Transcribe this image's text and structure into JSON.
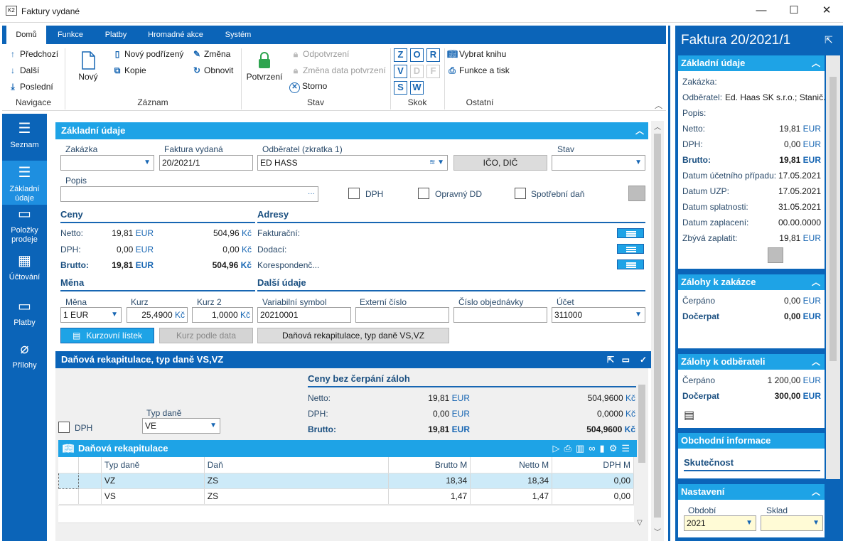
{
  "window": {
    "title": "Faktury vydané",
    "app_icon": "K2"
  },
  "ribbon_tabs": [
    "Domů",
    "Funkce",
    "Platby",
    "Hromadné akce",
    "Systém"
  ],
  "ribbon": {
    "nav": {
      "prev": "Předchozí",
      "next": "Další",
      "last": "Poslední",
      "group": "Navigace"
    },
    "record": {
      "new": "Nový",
      "new_child": "Nový podřízený",
      "copy": "Kopie",
      "change": "Změna",
      "refresh": "Obnovit",
      "group": "Záznam"
    },
    "state": {
      "confirm": "Potvrzení",
      "unconfirm": "Odpotvrzení",
      "change_date": "Změna data potvrzení",
      "cancel": "Storno",
      "group": "Stav"
    },
    "jump": {
      "keys": [
        "Z",
        "O",
        "R",
        "V",
        "D",
        "F",
        "S",
        "W"
      ],
      "group": "Skok"
    },
    "other": {
      "select_book": "Vybrat knihu",
      "functions_print": "Funkce a tisk",
      "group": "Ostatní"
    }
  },
  "leftnav": [
    {
      "label": "Seznam",
      "icon": "list-icon"
    },
    {
      "label": "Základní údaje",
      "icon": "details-icon"
    },
    {
      "label": "Položky prodeje",
      "icon": "box-icon"
    },
    {
      "label": "Účtování",
      "icon": "calculator-icon"
    },
    {
      "label": "Platby",
      "icon": "tray-icon"
    },
    {
      "label": "Přílohy",
      "icon": "paperclip-icon"
    }
  ],
  "basic": {
    "header": "Základní údaje",
    "zakazka_label": "Zakázka",
    "zakazka_value": "",
    "faktura_label": "Faktura vydaná",
    "faktura_value": "20/2021/1",
    "odberatel_label": "Odběratel (zkratka 1)",
    "odberatel_value": "ED HASS",
    "ico_button": "IČO, DIČ",
    "stav_label": "Stav",
    "stav_value": "",
    "popis_label": "Popis",
    "popis_value": "",
    "popis_dots": "···",
    "dph_cb": "DPH",
    "opravny_cb": "Opravný DD",
    "spotrebni_cb": "Spotřební daň"
  },
  "ceny": {
    "header": "Ceny",
    "rows": [
      {
        "label": "Netto:",
        "eur": "19,81",
        "eur_unit": "EUR",
        "czk": "504,96",
        "czk_unit": "Kč"
      },
      {
        "label": "DPH:",
        "eur": "0,00",
        "eur_unit": "EUR",
        "czk": "0,00",
        "czk_unit": "Kč"
      },
      {
        "label": "Brutto:",
        "eur": "19,81",
        "eur_unit": "EUR",
        "czk": "504,96",
        "czk_unit": "Kč"
      }
    ]
  },
  "adresy": {
    "header": "Adresy",
    "rows": [
      "Fakturační:",
      "Dodací:",
      "Korespondenč..."
    ]
  },
  "mena": {
    "header": "Měna",
    "mena_label": "Měna",
    "mena_value": "1 EUR",
    "kurz_label": "Kurz",
    "kurz_value": "25,4900",
    "kurz_unit": "Kč",
    "kurz2_label": "Kurz 2",
    "kurz2_value": "1,0000",
    "kurz2_unit": "Kč",
    "kurzovni_btn": "Kurzovní lístek",
    "kurz_data_btn": "Kurz podle data"
  },
  "dalsi": {
    "header": "Další údaje",
    "vs_label": "Variabilní symbol",
    "vs_value": "20210001",
    "ext_label": "Externí číslo",
    "ext_value": "",
    "obj_label": "Číslo objednávky",
    "obj_value": "",
    "ucet_label": "Účet",
    "ucet_value": "311000",
    "danova_btn": "Daňová rekapitulace, typ daně VS,VZ"
  },
  "tax": {
    "header": "Daňová rekapitulace, typ daně VS,VZ",
    "dph_cb": "DPH",
    "typ_dane_label": "Typ daně",
    "typ_dane_value": "VE",
    "ceny_header": "Ceny bez čerpání záloh",
    "rows": [
      {
        "label": "Netto:",
        "eur": "19,81",
        "eur_unit": "EUR",
        "czk": "504,9600",
        "czk_unit": "Kč"
      },
      {
        "label": "DPH:",
        "eur": "0,00",
        "eur_unit": "EUR",
        "czk": "0,0000",
        "czk_unit": "Kč"
      },
      {
        "label": "Brutto:",
        "eur": "19,81",
        "eur_unit": "EUR",
        "czk": "504,9600",
        "czk_unit": "Kč"
      }
    ],
    "grid_title": "Daňová rekapitulace",
    "columns": [
      "Typ daně",
      "Daň",
      "Brutto M",
      "Netto M",
      "DPH M"
    ],
    "grid_rows": [
      [
        "VZ",
        "ZS",
        "18,34",
        "18,34",
        "0,00"
      ],
      [
        "VS",
        "ZS",
        "1,47",
        "1,47",
        "0,00"
      ]
    ]
  },
  "right": {
    "title": "Faktura 20/2021/1",
    "basic_header": "Základní údaje",
    "basic_rows": [
      {
        "label": "Zakázka:",
        "value": ""
      },
      {
        "label": "Odběratel:",
        "value": "Ed. Haas SK s.r.o.; Stanič..."
      },
      {
        "label": "Popis:",
        "value": ""
      },
      {
        "label": "Netto:",
        "value": "19,81",
        "unit": "EUR"
      },
      {
        "label": "DPH:",
        "value": "0,00",
        "unit": "EUR"
      },
      {
        "label": "Brutto:",
        "value": "19,81",
        "unit": "EUR"
      },
      {
        "label": "Datum účetního případu:",
        "value": "17.05.2021"
      },
      {
        "label": "Datum UZP:",
        "value": "17.05.2021"
      },
      {
        "label": "Datum splatnosti:",
        "value": "31.05.2021"
      },
      {
        "label": "Datum zaplacení:",
        "value": "00.00.0000"
      },
      {
        "label": "Zbývá zaplatit:",
        "value": "19,81",
        "unit": "EUR"
      }
    ],
    "zalohy_zak_header": "Zálohy k zakázce",
    "zalohy_zak": [
      {
        "label": "Čerpáno",
        "value": "0,00",
        "unit": "EUR"
      },
      {
        "label": "Dočerpat",
        "value": "0,00",
        "unit": "EUR"
      }
    ],
    "zalohy_odb_header": "Zálohy k odběrateli",
    "zalohy_odb": [
      {
        "label": "Čerpáno",
        "value": "1 200,00",
        "unit": "EUR"
      },
      {
        "label": "Dočerpat",
        "value": "300,00",
        "unit": "EUR"
      }
    ],
    "obchodni_header": "Obchodní informace",
    "skutecnost": "Skutečnost",
    "nastaveni_header": "Nastavení",
    "obdobi_label": "Období",
    "obdobi_value": "2021",
    "sklad_label": "Sklad",
    "sklad_value": ""
  }
}
